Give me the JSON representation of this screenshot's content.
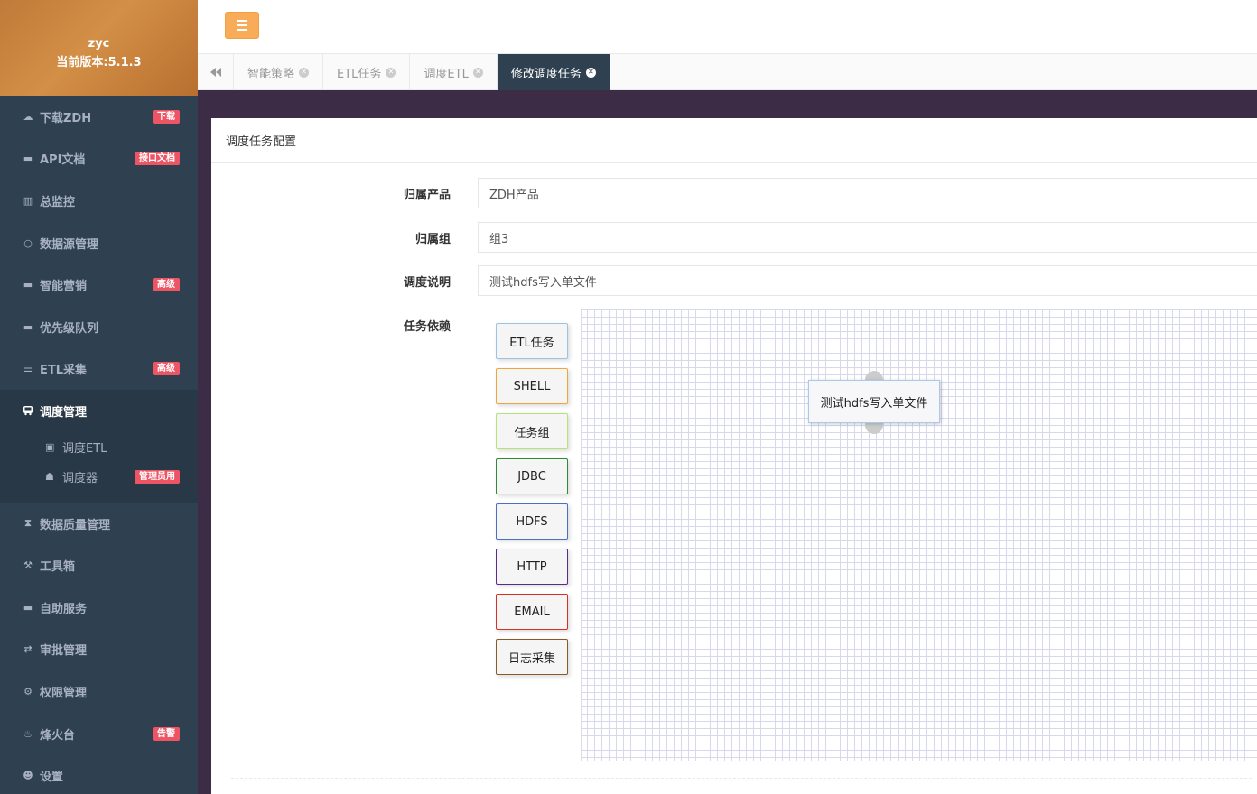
{
  "profile": {
    "user": "zyc",
    "version": "当前版本:5.1.3"
  },
  "sidebar": {
    "items_top": [
      {
        "label": "下载ZDH",
        "icon": "cloud-download-icon",
        "badge": "下载"
      },
      {
        "label": "API文档",
        "icon": "coffee-icon",
        "badge": "接口文档"
      },
      {
        "label": "总监控",
        "icon": "bar-chart-icon",
        "badge": ""
      },
      {
        "label": "数据源管理",
        "icon": "circle-icon",
        "badge": ""
      },
      {
        "label": "智能营销",
        "icon": "coffee-icon",
        "badge": "高级"
      },
      {
        "label": "优先级队列",
        "icon": "coffee-icon",
        "badge": ""
      },
      {
        "label": "ETL采集",
        "icon": "list-icon",
        "badge": "高级"
      }
    ],
    "active_group": {
      "label": "调度管理",
      "icon": "bus-icon",
      "children": [
        {
          "label": "调度ETL",
          "icon": "bus-icon",
          "badge": ""
        },
        {
          "label": "调度器",
          "icon": "user-secret-icon",
          "badge": "管理员用"
        }
      ]
    },
    "items_bottom": [
      {
        "label": "数据质量管理",
        "icon": "hourglass-icon",
        "badge": ""
      },
      {
        "label": "工具箱",
        "icon": "gavel-icon",
        "badge": ""
      },
      {
        "label": "自助服务",
        "icon": "coffee-icon",
        "badge": ""
      },
      {
        "label": "审批管理",
        "icon": "exchange-icon",
        "badge": ""
      },
      {
        "label": "权限管理",
        "icon": "gear-icon",
        "badge": ""
      },
      {
        "label": "烽火台",
        "icon": "fire-extinguisher-icon",
        "badge": "告警"
      },
      {
        "label": "设置",
        "icon": "user-icon",
        "badge": ""
      }
    ]
  },
  "tabs": [
    {
      "label": "智能策略",
      "active": false
    },
    {
      "label": "ETL任务",
      "active": false
    },
    {
      "label": "调度ETL",
      "active": false
    },
    {
      "label": "修改调度任务",
      "active": true
    }
  ],
  "panel": {
    "title": "调度任务配置",
    "fields": [
      {
        "label": "归属产品",
        "value": "ZDH产品"
      },
      {
        "label": "归属组",
        "value": "组3"
      },
      {
        "label": "调度说明",
        "value": "测试hdfs写入单文件"
      }
    ],
    "dependency_label": "任务依赖",
    "palette": [
      {
        "label": "ETL任务",
        "color": "#9cc3e6"
      },
      {
        "label": "SHELL",
        "color": "#f0a63a"
      },
      {
        "label": "任务组",
        "color": "#b5e27a"
      },
      {
        "label": "JDBC",
        "color": "#2e8b3a"
      },
      {
        "label": "HDFS",
        "color": "#4a6fc7"
      },
      {
        "label": "HTTP",
        "color": "#5a2b8a"
      },
      {
        "label": "EMAIL",
        "color": "#d93025"
      },
      {
        "label": "日志采集",
        "color": "#8b5a2b"
      }
    ],
    "flow_nodes": [
      {
        "label": "测试hdfs写入单文件"
      }
    ]
  }
}
